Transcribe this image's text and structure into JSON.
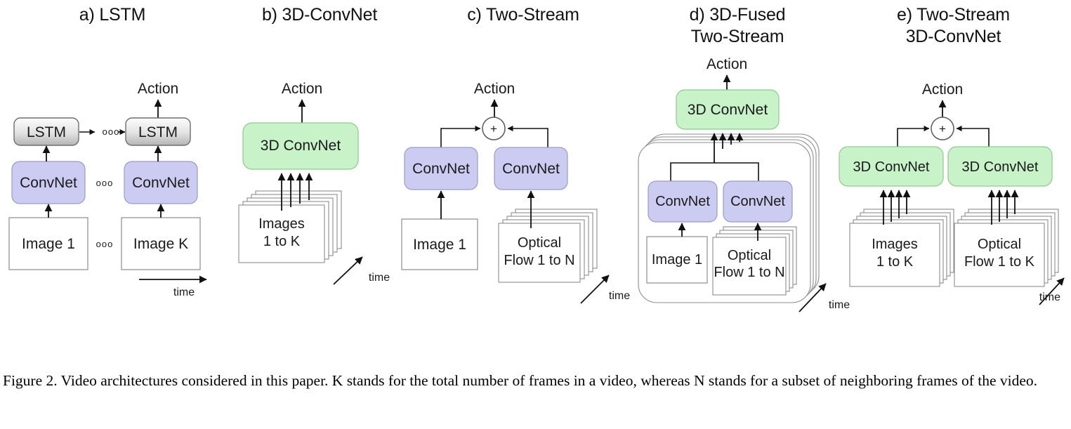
{
  "figure": {
    "caption": "Figure 2. Video architectures considered in this paper. K stands for the total number of frames in a video, whereas N stands for a subset of neighboring frames of the video.",
    "background": "#ffffff"
  },
  "colors": {
    "convnet_fill": "#ccccf2",
    "convnet_stroke": "#9a9ac8",
    "convnet3d_fill": "#c8f2c8",
    "convnet3d_stroke": "#8fc98f",
    "lstm_fill_top": "#fdfdfd",
    "lstm_fill_bottom": "#b9b9b9",
    "lstm_stroke": "#6e6e6e",
    "frame_fill": "#ffffff",
    "frame_stroke": "#8c8c8c",
    "arrow": "#111111",
    "text": "#1a1a1a"
  },
  "panels": [
    {
      "id": "lstm",
      "title": "a) LSTM",
      "output_label": "Action",
      "time_label": "time",
      "ellipsis": "ooo",
      "blocks": [
        {
          "name": "lstm-block-1",
          "label": "LSTM",
          "type": "lstm"
        },
        {
          "name": "lstm-block-k",
          "label": "LSTM",
          "type": "lstm"
        },
        {
          "name": "convnet-block-1",
          "label": "ConvNet",
          "type": "convnet"
        },
        {
          "name": "convnet-block-k",
          "label": "ConvNet",
          "type": "convnet"
        },
        {
          "name": "input-frame-1",
          "label": "Image 1",
          "type": "frame"
        },
        {
          "name": "input-frame-k",
          "label": "Image K",
          "type": "frame"
        }
      ]
    },
    {
      "id": "3d-convnet",
      "title": "b) 3D-ConvNet",
      "output_label": "Action",
      "time_label": "time",
      "blocks": [
        {
          "name": "convnet3d-block",
          "label": "3D ConvNet",
          "type": "convnet3d"
        },
        {
          "name": "input-image-stack",
          "label_line1": "Images",
          "label_line2": "1 to K",
          "type": "stack",
          "layers": 5
        }
      ]
    },
    {
      "id": "two-stream",
      "title": "c) Two-Stream",
      "output_label": "Action",
      "time_label": "time",
      "fusion_label": "+",
      "blocks": [
        {
          "name": "convnet-block-rgb",
          "label": "ConvNet",
          "type": "convnet"
        },
        {
          "name": "convnet-block-flow",
          "label": "ConvNet",
          "type": "convnet"
        },
        {
          "name": "input-frame-image1",
          "label": "Image 1",
          "type": "frame"
        },
        {
          "name": "input-flow-stack",
          "label_line1": "Optical",
          "label_line2": "Flow 1 to N",
          "type": "stack",
          "layers": 5
        }
      ]
    },
    {
      "id": "3d-fused-two-stream",
      "title": "d) 3D-Fused\nTwo-Stream",
      "output_label": "Action",
      "time_label": "time",
      "blocks": [
        {
          "name": "convnet3d-block",
          "label": "3D ConvNet",
          "type": "convnet3d"
        },
        {
          "name": "convnet-block-rgb",
          "label": "ConvNet",
          "type": "convnet"
        },
        {
          "name": "convnet-block-flow",
          "label": "ConvNet",
          "type": "convnet"
        },
        {
          "name": "input-frame-image1",
          "label": "Image 1",
          "type": "frame"
        },
        {
          "name": "input-flow-stack",
          "label_line1": "Optical",
          "label_line2": "Flow 1 to N",
          "type": "stack",
          "layers": 4
        },
        {
          "name": "fused-stream-container",
          "label": "",
          "type": "container-stack",
          "layers": 4
        }
      ]
    },
    {
      "id": "two-stream-3d-convnet",
      "title": "e) Two-Stream\n3D-ConvNet",
      "output_label": "Action",
      "time_label": "time",
      "fusion_label": "+",
      "blocks": [
        {
          "name": "convnet3d-block-rgb",
          "label": "3D ConvNet",
          "type": "convnet3d"
        },
        {
          "name": "convnet3d-block-flow",
          "label": "3D ConvNet",
          "type": "convnet3d"
        },
        {
          "name": "input-image-stack",
          "label_line1": "Images",
          "label_line2": "1 to K",
          "type": "stack",
          "layers": 5
        },
        {
          "name": "input-flow-stack",
          "label_line1": "Optical",
          "label_line2": "Flow 1 to K",
          "type": "stack",
          "layers": 5
        }
      ]
    }
  ]
}
